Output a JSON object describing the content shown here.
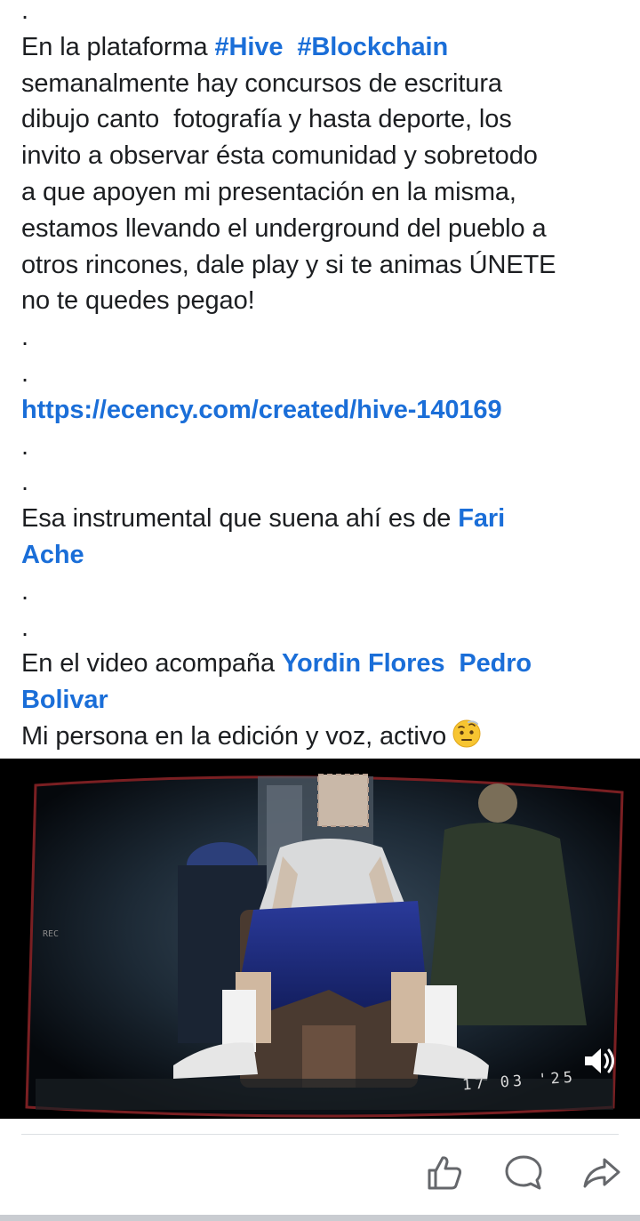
{
  "post": {
    "lines": [
      {
        "id": "l0",
        "parts": [
          {
            "t": "."
          }
        ]
      },
      {
        "id": "l1",
        "parts": [
          {
            "t": "En la plataforma "
          },
          {
            "t": "#Hive",
            "link": true
          },
          {
            "t": "  "
          },
          {
            "t": "#Blockchain",
            "link": true
          }
        ]
      },
      {
        "id": "l2",
        "parts": [
          {
            "t": "semanalmente hay concursos de escritura"
          }
        ]
      },
      {
        "id": "l3",
        "parts": [
          {
            "t": "dibujo canto  fotografía y hasta deporte, los"
          }
        ]
      },
      {
        "id": "l4",
        "parts": [
          {
            "t": "invito a observar ésta comunidad y sobretodo"
          }
        ]
      },
      {
        "id": "l5",
        "parts": [
          {
            "t": "a que apoyen mi presentación en la misma,"
          }
        ]
      },
      {
        "id": "l6",
        "parts": [
          {
            "t": "estamos llevando el underground del pueblo a"
          }
        ]
      },
      {
        "id": "l7",
        "parts": [
          {
            "t": "otros rincones, dale play y si te animas ÚNETE"
          }
        ]
      },
      {
        "id": "l8",
        "parts": [
          {
            "t": "no te quedes pegao!"
          }
        ]
      },
      {
        "id": "l9",
        "parts": [
          {
            "t": "."
          }
        ]
      },
      {
        "id": "l10",
        "parts": [
          {
            "t": "."
          }
        ]
      },
      {
        "id": "l11",
        "parts": [
          {
            "t": "https://ecency.com/created/hive-140169",
            "link": true
          }
        ]
      },
      {
        "id": "l12",
        "parts": [
          {
            "t": "."
          }
        ]
      },
      {
        "id": "l13",
        "parts": [
          {
            "t": "."
          }
        ]
      },
      {
        "id": "l14",
        "parts": [
          {
            "t": "Esa instrumental que suena ahí es de "
          },
          {
            "t": "Fari",
            "link": true
          }
        ]
      },
      {
        "id": "l15",
        "parts": [
          {
            "t": "Ache",
            "link": true
          }
        ]
      },
      {
        "id": "l16",
        "parts": [
          {
            "t": "."
          }
        ]
      },
      {
        "id": "l17",
        "parts": [
          {
            "t": "."
          }
        ]
      },
      {
        "id": "l18",
        "parts": [
          {
            "t": "En el video acompaña "
          },
          {
            "t": "Yordin Flores",
            "link": true
          },
          {
            "t": "  "
          },
          {
            "t": "Pedro",
            "link": true
          }
        ]
      },
      {
        "id": "l19",
        "parts": [
          {
            "t": "Bolivar",
            "link": true
          }
        ]
      },
      {
        "id": "l20",
        "parts": [
          {
            "t": "Mi persona en la edición y voz, activo"
          }
        ],
        "emoji": "face-with-raised-eyebrow-icon"
      }
    ]
  },
  "video": {
    "timestamp": "17 03 '25",
    "volume_icon": "volume-on-icon"
  },
  "actions": [
    {
      "name": "like-button",
      "icon": "thumbs-up-icon"
    },
    {
      "name": "comment-button",
      "icon": "speech-bubble-icon"
    },
    {
      "name": "share-button",
      "icon": "share-arrow-icon"
    }
  ],
  "colors": {
    "link": "#1a6ed8",
    "text": "#1c1e21",
    "divider": "#dcdfe3",
    "icon": "#65676b"
  }
}
